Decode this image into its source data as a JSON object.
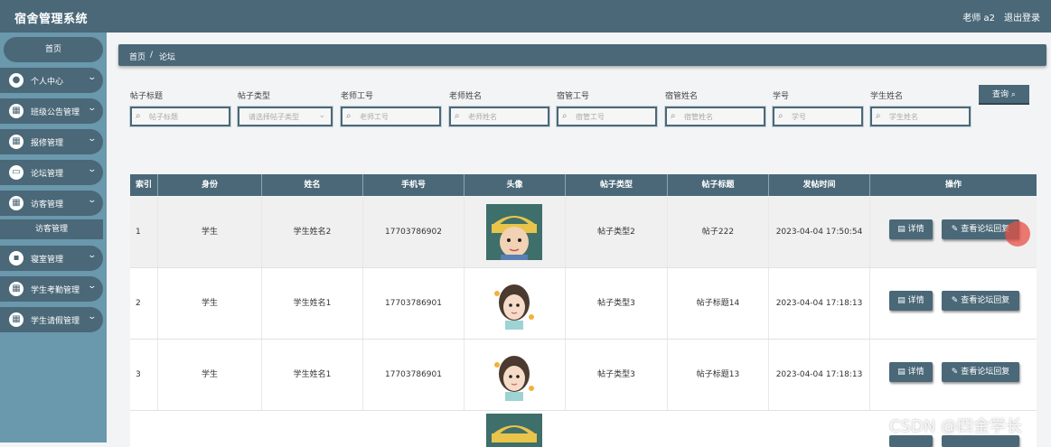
{
  "header": {
    "title": "宿舍管理系统",
    "user": "老师 a2",
    "logout": "退出登录"
  },
  "sidebar": {
    "home": "首页",
    "items": [
      {
        "label": "个人中心",
        "icon": "user-icon"
      },
      {
        "label": "班级公告管理",
        "icon": "grid-icon"
      },
      {
        "label": "报修管理",
        "icon": "grid-icon"
      },
      {
        "label": "论坛管理",
        "icon": "monitor-icon"
      },
      {
        "label": "访客管理",
        "icon": "grid-icon"
      },
      {
        "label": "寝室管理",
        "icon": "chat-icon"
      },
      {
        "label": "学生考勤管理",
        "icon": "grid-icon"
      },
      {
        "label": "学生请假管理",
        "icon": "grid-icon"
      }
    ],
    "sub_item": "访客管理"
  },
  "breadcrumb": {
    "home": "首页",
    "sep": "/",
    "current": "论坛"
  },
  "filters": [
    {
      "label": "帖子标题",
      "placeholder": "帖子标题"
    },
    {
      "label": "帖子类型",
      "placeholder": "请选择帖子类型"
    },
    {
      "label": "老师工号",
      "placeholder": "老师工号"
    },
    {
      "label": "老师姓名",
      "placeholder": "老师姓名"
    },
    {
      "label": "宿管工号",
      "placeholder": "宿管工号"
    },
    {
      "label": "宿管姓名",
      "placeholder": "宿管姓名"
    },
    {
      "label": "学号",
      "placeholder": "学号"
    },
    {
      "label": "学生姓名",
      "placeholder": "学生姓名"
    }
  ],
  "query_button": "查询",
  "table": {
    "headers": [
      "索引",
      "身份",
      "姓名",
      "手机号",
      "头像",
      "帖子类型",
      "帖子标题",
      "发帖时间",
      "操作"
    ],
    "rows": [
      {
        "index": "1",
        "identity": "学生",
        "name": "学生姓名2",
        "phone": "17703786902",
        "type": "帖子类型2",
        "title": "帖子222",
        "time": "2023-04-04 17:50:54"
      },
      {
        "index": "2",
        "identity": "学生",
        "name": "学生姓名1",
        "phone": "17703786901",
        "type": "帖子类型3",
        "title": "帖子标题14",
        "time": "2023-04-04 17:18:13"
      },
      {
        "index": "3",
        "identity": "学生",
        "name": "学生姓名1",
        "phone": "17703786901",
        "type": "帖子类型3",
        "title": "帖子标题13",
        "time": "2023-04-04 17:18:13"
      }
    ],
    "detail_label": "详情",
    "reply_label": "查看论坛回复"
  },
  "watermark": "CSDN @四金学长"
}
